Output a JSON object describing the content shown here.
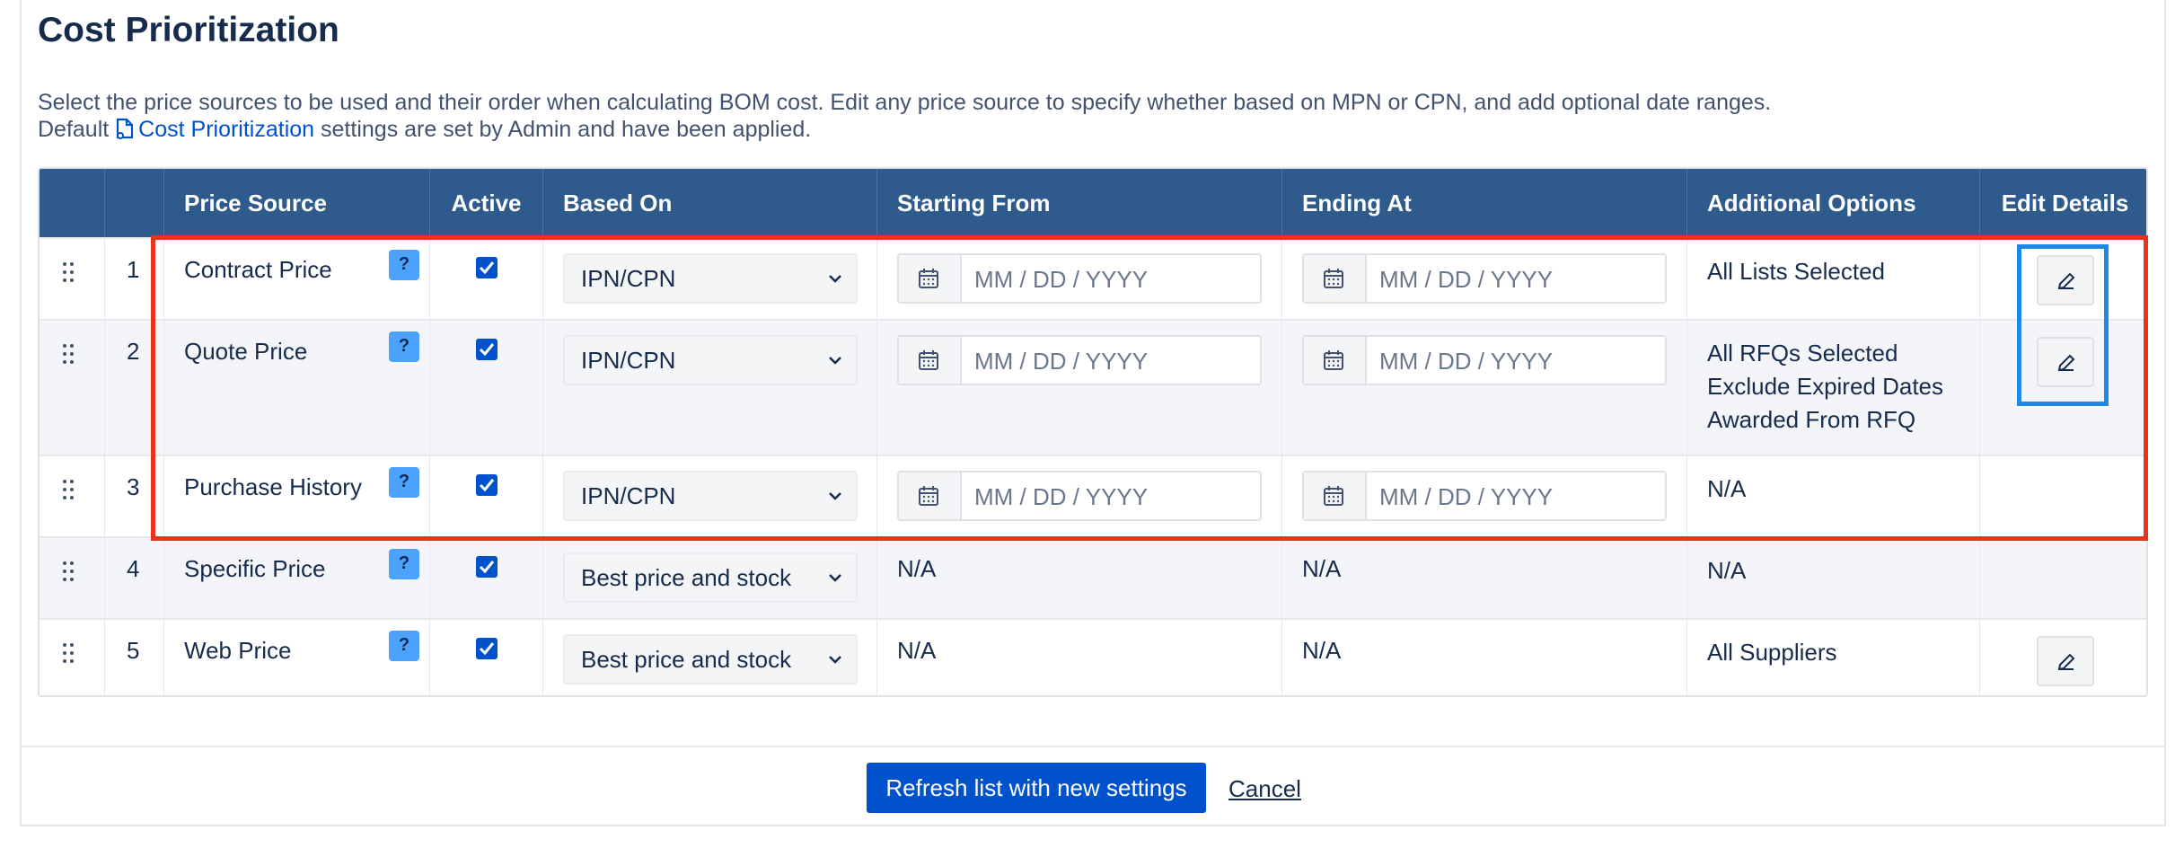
{
  "page": {
    "title": "Cost Prioritization",
    "description_line1": "Select the price sources to be used and their order when calculating BOM cost. Edit any price source to specify whether based on MPN or CPN, and add optional date ranges.",
    "description_prefix": "Default",
    "description_link": "Cost Prioritization",
    "description_suffix": "settings are set by Admin and have been applied."
  },
  "table": {
    "headers": {
      "price_source": "Price Source",
      "active": "Active",
      "based_on": "Based On",
      "starting_from": "Starting From",
      "ending_at": "Ending At",
      "additional_options": "Additional Options",
      "edit_details": "Edit Details"
    },
    "help_label": "?",
    "date_placeholder": "MM / DD / YYYY",
    "rows": [
      {
        "index": "1",
        "source": "Contract Price",
        "active": true,
        "based_on": "IPN/CPN",
        "start": "",
        "end": "",
        "options": [
          "All Lists Selected"
        ],
        "editable": true
      },
      {
        "index": "2",
        "source": "Quote Price",
        "active": true,
        "based_on": "IPN/CPN",
        "start": "",
        "end": "",
        "options": [
          "All RFQs Selected",
          "Exclude Expired Dates",
          "Awarded From RFQ"
        ],
        "editable": true
      },
      {
        "index": "3",
        "source": "Purchase History",
        "active": true,
        "based_on": "IPN/CPN",
        "start": "",
        "end": "",
        "options": [
          "N/A"
        ],
        "editable": false
      },
      {
        "index": "4",
        "source": "Specific Price",
        "active": true,
        "based_on": "Best price and stock",
        "start": "N/A",
        "end": "N/A",
        "options": [
          "N/A"
        ],
        "editable": false
      },
      {
        "index": "5",
        "source": "Web Price",
        "active": true,
        "based_on": "Best price and stock",
        "start": "N/A",
        "end": "N/A",
        "options": [
          "All Suppliers"
        ],
        "editable": true
      }
    ]
  },
  "footer": {
    "primary_label": "Refresh list with new settings",
    "cancel_label": "Cancel"
  },
  "colors": {
    "header_bg": "#2e5a8c",
    "primary": "#0052cc",
    "highlight_red": "#e8341c",
    "highlight_blue": "#1e88e5"
  }
}
